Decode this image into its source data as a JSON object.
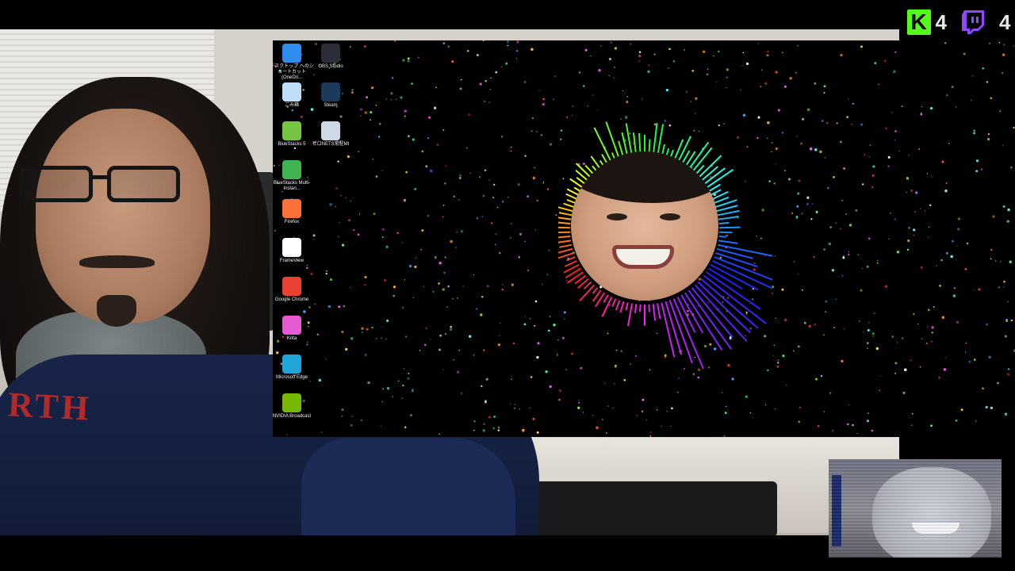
{
  "overlay": {
    "kick_count": "4",
    "twitch_count": "4",
    "colors": {
      "kick": "#53fc18",
      "twitch": "#9146ff"
    },
    "kick_icon": "kick-logo-icon",
    "twitch_icon": "twitch-logo-icon"
  },
  "webcam": {
    "hoodie_text": "RTH"
  },
  "desktop": {
    "icons_left": [
      {
        "label": "デスクトップ へのショートカット (OneDri...",
        "icon": "onedrive-icon",
        "color": "#2e8ef0"
      },
      {
        "label": "ごみ箱",
        "icon": "recycle-bin-icon",
        "color": "#bcdff7"
      },
      {
        "label": "BlueStacks 5",
        "icon": "bluestacks-icon",
        "color": "#76c442"
      },
      {
        "label": "BlueStacks Multi-Instan...",
        "icon": "bluestacks-multi-icon",
        "color": "#3fb34f"
      },
      {
        "label": "Firefox",
        "icon": "firefox-icon",
        "color": "#ff7139"
      },
      {
        "label": "FrameView",
        "icon": "frameview-icon",
        "color": "#ffffff"
      },
      {
        "label": "Google Chrome",
        "icon": "chrome-icon",
        "color": "#e94235"
      },
      {
        "label": "Krita",
        "icon": "krita-icon",
        "color": "#e55bd0"
      },
      {
        "label": "Microsoft Edge",
        "icon": "edge-icon",
        "color": "#1fa6d6"
      },
      {
        "label": "NVIDIA Broadcast",
        "icon": "nvidia-broadcast-icon",
        "color": "#76b900"
      }
    ],
    "icons_right": [
      {
        "label": "OBS Studio",
        "icon": "obs-icon",
        "color": "#2b2e38"
      },
      {
        "label": "Steam",
        "icon": "steam-icon",
        "color": "#1b3a5c"
      },
      {
        "label": "ゼロNETS常駐MI",
        "icon": "zero-nets-icon",
        "color": "#cfd8e6"
      }
    ]
  }
}
